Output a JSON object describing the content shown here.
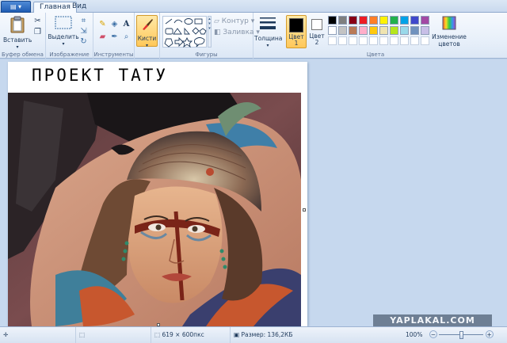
{
  "app": {
    "menu_icon": "menu-icon",
    "tabs": [
      {
        "label": "Главная",
        "active": true
      },
      {
        "label": "Вид",
        "active": false
      }
    ]
  },
  "ribbon": {
    "clipboard": {
      "paste_label": "Вставить",
      "group_label": "Буфер обмена",
      "icons": [
        "paste-icon",
        "cut-icon",
        "copy-icon"
      ]
    },
    "image": {
      "select_label": "Выделить",
      "group_label": "Изображение",
      "icons": [
        "crop-icon",
        "resize-icon",
        "rotate-icon"
      ]
    },
    "tools": {
      "group_label": "Инструменты",
      "icons": [
        "pencil-icon",
        "fill-icon",
        "text-icon",
        "eraser-icon",
        "color-picker-icon",
        "magnifier-icon"
      ]
    },
    "brushes": {
      "label": "Кисти"
    },
    "shapes": {
      "group_label": "Фигуры",
      "outline_label": "Контур",
      "fill_label": "Заливка"
    },
    "size": {
      "label": "Толщина"
    },
    "color1": {
      "label_line1": "Цвет",
      "label_line2": "1",
      "value": "#000000"
    },
    "color2": {
      "label_line1": "Цвет",
      "label_line2": "2",
      "value": "#ffffff"
    },
    "colors": {
      "group_label": "Цвета",
      "edit_label_line1": "Изменение",
      "edit_label_line2": "цветов",
      "row1": [
        "#000000",
        "#7f7f7f",
        "#880015",
        "#ed1c24",
        "#ff7f27",
        "#fff200",
        "#22b14c",
        "#00a2e8",
        "#3f48cc",
        "#a349a4"
      ],
      "row2": [
        "#ffffff",
        "#c3c3c3",
        "#b97a57",
        "#ffaec9",
        "#ffc90e",
        "#efe4b0",
        "#b5e61d",
        "#99d9ea",
        "#7092be",
        "#c8bfe7"
      ]
    }
  },
  "canvas": {
    "handwriting": "ПРОЕКТ ТАТУ"
  },
  "watermark": "YAPLAKAL.COM",
  "status": {
    "dimensions": "619 × 600пкс",
    "file_size": "Размер: 136,2КБ",
    "zoom": "100%",
    "zoom_out": "−",
    "zoom_in": "+"
  }
}
